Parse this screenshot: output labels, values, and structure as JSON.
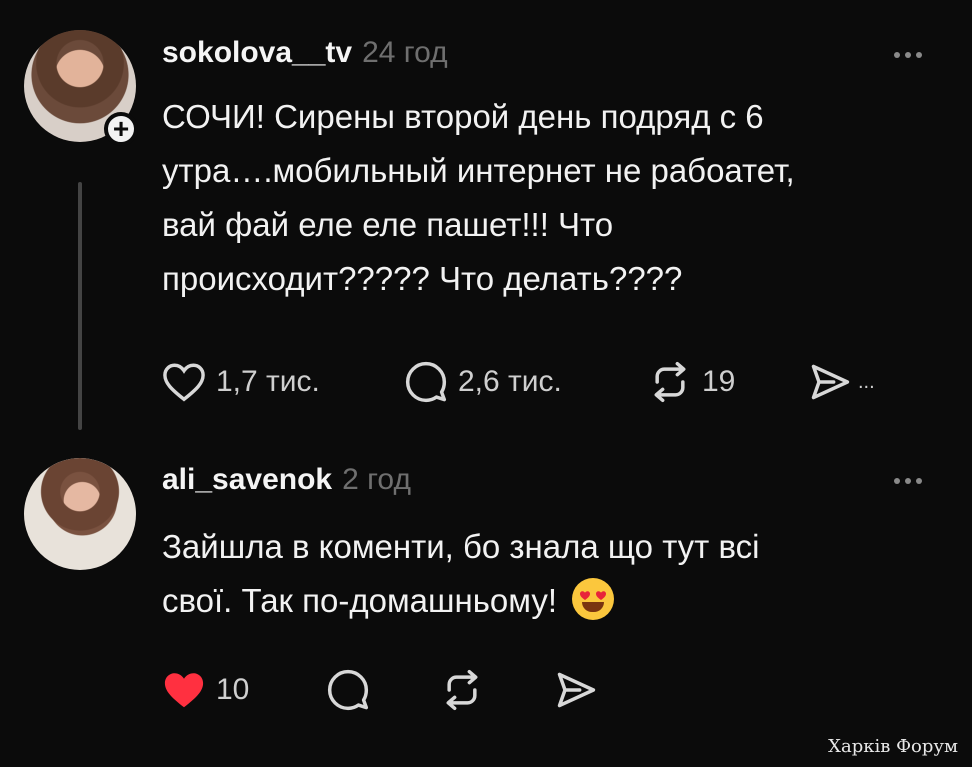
{
  "posts": [
    {
      "username": "sokolova__tv",
      "time": "24 год",
      "text_lines": [
        "СОЧИ! Сирены второй день подряд с 6",
        "утра….мобильный интернет не рабоатет,",
        "вай фай еле еле пашет!!! Что",
        "происходит????? Что делать????"
      ],
      "likes": "1,7 тис.",
      "comments": "2,6 тис.",
      "reposts": "19",
      "share_more": "..."
    },
    {
      "username": "ali_savenok",
      "time": "2 год",
      "text_lines": [
        "Зайшла в коменти, бо знала що тут всі",
        "свої. Так по-домашньому!"
      ],
      "likes": "10"
    }
  ],
  "icons": {
    "like": "heart-icon",
    "comment": "comment-icon",
    "repost": "repost-icon",
    "share": "share-icon",
    "follow": "plus-icon",
    "more": "more-dots-icon",
    "emoji": "heart-eyes-emoji"
  },
  "colors": {
    "background": "#0b0b0b",
    "liked_heart": "#ff3040",
    "muted": "#6f6f6f"
  },
  "watermark": "Харків Форум"
}
